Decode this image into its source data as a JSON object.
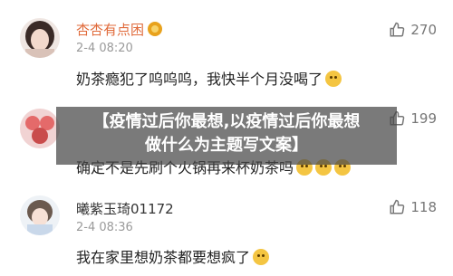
{
  "comments": [
    {
      "username": "杏杏有点困",
      "timestamp": "2-4 08:20",
      "text": "奶茶瘾犯了呜呜呜，我快半个月没喝了",
      "likes": "270",
      "user_color": "#e06a3a"
    },
    {
      "username": "",
      "timestamp": "",
      "text": "确定不是先刷个火锅再来杯奶茶吗",
      "likes": "199"
    },
    {
      "username": "曦紫玉琦01172",
      "timestamp": "2-4 08:36",
      "text": "我在家里想奶茶都要想疯了",
      "likes": "118"
    }
  ],
  "headline": {
    "line1": "【疫情过后你最想,以疫情过后你最想",
    "line2": "做什么为主题写文案】"
  },
  "icons": {
    "like": "thumbs-up-icon",
    "emoji": "emoji-icon",
    "badge": "vip-badge-icon"
  }
}
